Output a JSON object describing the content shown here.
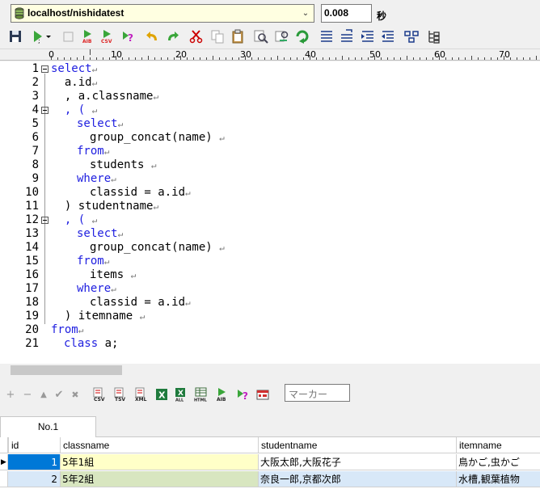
{
  "connection": {
    "label": "localhost/nishidatest"
  },
  "timer": {
    "value": "0.008",
    "unit": "秒"
  },
  "ruler": {
    "marks": [
      "0",
      "10",
      "20",
      "30",
      "40",
      "50",
      "60",
      "70"
    ]
  },
  "editor": {
    "lines": [
      {
        "n": "1"
      },
      {
        "n": "2"
      },
      {
        "n": "3"
      },
      {
        "n": "4"
      },
      {
        "n": "5"
      },
      {
        "n": "6"
      },
      {
        "n": "7"
      },
      {
        "n": "8"
      },
      {
        "n": "9"
      },
      {
        "n": "10"
      },
      {
        "n": "11"
      },
      {
        "n": "12"
      },
      {
        "n": "13"
      },
      {
        "n": "14"
      },
      {
        "n": "15"
      },
      {
        "n": "16"
      },
      {
        "n": "17"
      },
      {
        "n": "18"
      },
      {
        "n": "19"
      },
      {
        "n": "20"
      },
      {
        "n": "21"
      }
    ],
    "code": {
      "l1_kw": "select",
      "l2": "  a.id",
      "l3": "  , a.classname",
      "l4": "  , ( ",
      "l5_kw": "select",
      "l6": "group_concat(name) ",
      "l7_kw": "from",
      "l8": "students ",
      "l9_kw": "where",
      "l10": "classid = a.id",
      "l11": "  ) studentname",
      "l12": "  , ( ",
      "l13_kw": "select",
      "l14": "group_concat(name) ",
      "l15_kw": "from",
      "l16": "items ",
      "l17_kw": "where",
      "l18": "classid = a.id",
      "l19": "  ) itemname ",
      "l20_kw": "from",
      "l21_kw": "class",
      "l21_rest": " a;"
    },
    "eol_mark": "↵"
  },
  "grid_toolbar": {
    "filter_placeholder": "マーカー",
    "add": "+",
    "remove": "−",
    "up": "▲",
    "commit": "✔",
    "cancel": "✖"
  },
  "result_tabs": [
    {
      "label": "No.1"
    }
  ],
  "result": {
    "columns": [
      "id",
      "classname",
      "studentname",
      "itemname"
    ],
    "rows": [
      {
        "id": "1",
        "classname": "5年1組",
        "studentname": "大阪太郎,大阪花子",
        "itemname": "鳥かご,虫かご"
      },
      {
        "id": "2",
        "classname": "5年2組",
        "studentname": "奈良一郎,京都次郎",
        "itemname": "水槽,観葉植物"
      }
    ]
  },
  "colors": {
    "keyword": "#2020e0",
    "selected_id": "#0078d7",
    "row1": "#ffffc8",
    "row2": "#d8e8f8",
    "row2_classname": "#d8e6c0"
  }
}
